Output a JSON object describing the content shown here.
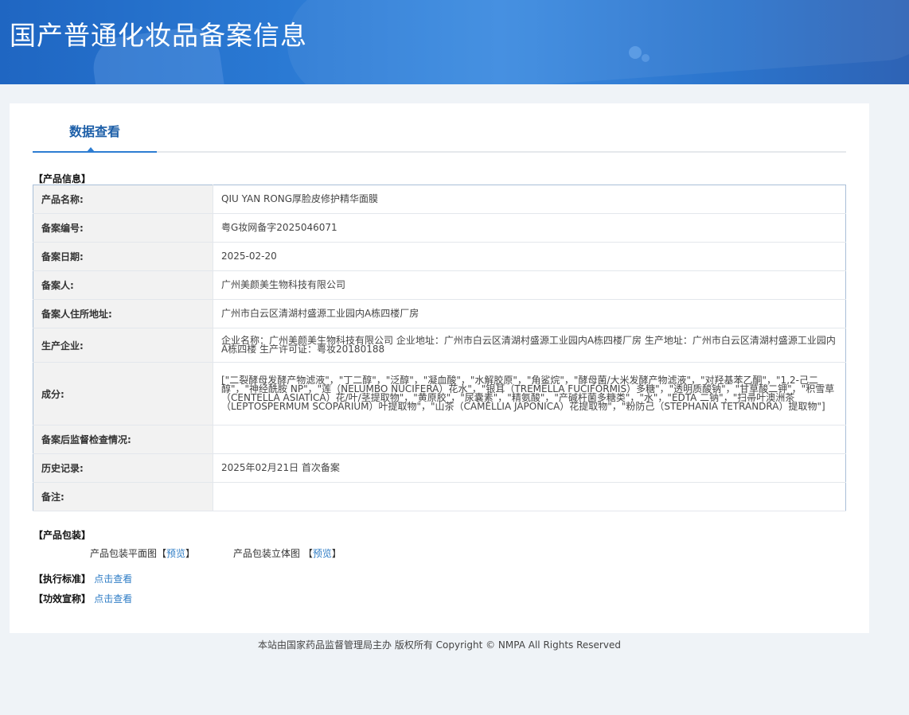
{
  "header": {
    "title": "国产普通化妆品备案信息"
  },
  "tab": {
    "label": "数据查看"
  },
  "product_info": {
    "section_title": "【产品信息】",
    "rows": [
      {
        "label": "产品名称:",
        "value": "QIU YAN RONG厚脸皮修护精华面膜"
      },
      {
        "label": "备案编号:",
        "value": "粤G妆网备字2025046071"
      },
      {
        "label": "备案日期:",
        "value": "2025-02-20"
      },
      {
        "label": "备案人:",
        "value": "广州美颜美生物科技有限公司"
      },
      {
        "label": "备案人住所地址:",
        "value": "广州市白云区清湖村盛源工业园内A栋四楼厂房"
      },
      {
        "label": "生产企业:",
        "value": "企业名称：广州美颜美生物科技有限公司 企业地址：广州市白云区清湖村盛源工业园内A栋四楼厂房 生产地址：广州市白云区清湖村盛源工业园内A栋四楼 生产许可证：粤妆20180188"
      },
      {
        "label": "成分:",
        "value": "[\"二裂酵母发酵产物滤液\"，\"丁二醇\"，\"泛醇\"，\"凝血酸\"，\"水解胶原\"，\"角鲨烷\"，\"酵母菌/大米发酵产物滤液\"，\"对羟基苯乙酮\"，\"1,2-己二醇\"，\"神经酰胺 NP\"，\"莲（NELUMBO NUCIFERA）花水\"，\"银耳（TREMELLA FUCIFORMIS）多糖\"，\"透明质酸钠\"，\"甘草酸二钾\"，\"积雪草（CENTELLA ASIATICA）花/叶/茎提取物\"，\"黄原胶\"，\"尿囊素\"，\"精氨酸\"，\"产碱杆菌多糖类\"，\"水\"，\"EDTA 二钠\"，\"扫帚叶澳洲茶（LEPTOSPERMUM SCOPARIUM）叶提取物\"，\"山茶（CAMELLIA JAPONICA）花提取物\"，\"粉防己（STEPHANIA TETRANDRA）提取物\"]"
      },
      {
        "label": "备案后监督检查情况:",
        "value": ""
      },
      {
        "label": "历史记录:",
        "value": "2025年02月21日 首次备案"
      },
      {
        "label": "备注:",
        "value": ""
      }
    ]
  },
  "packaging": {
    "section_title": "【产品包装】",
    "flat_label": "产品包装平面图",
    "solid_label": "产品包装立体图",
    "bracket_open": "【",
    "bracket_close": "】",
    "preview_link": "预览"
  },
  "standard": {
    "section_title": "【执行标准】",
    "link": "点击查看"
  },
  "efficacy": {
    "section_title": "【功效宣称】",
    "link": "点击查看"
  },
  "footer": {
    "text": "本站由国家药品监督管理局主办 版权所有 Copyright © NMPA All Rights Reserved"
  }
}
